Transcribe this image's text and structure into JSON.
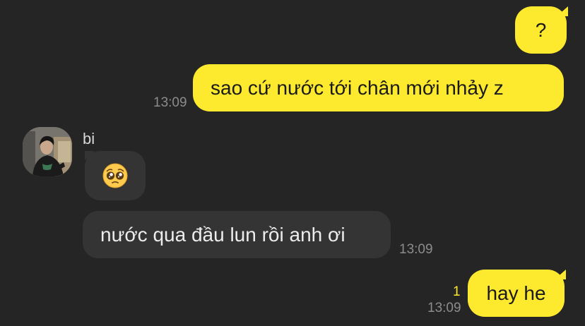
{
  "messages": [
    {
      "direction": "outgoing",
      "text": "?"
    },
    {
      "direction": "outgoing",
      "text": "sao cứ nước tới chân mới nhảy z",
      "time": "13:09"
    },
    {
      "direction": "incoming",
      "sender": "bi",
      "emoji": "pleading-face-emoji"
    },
    {
      "direction": "incoming",
      "text": "nước qua đầu lun rồi anh ơi",
      "time": "13:09"
    },
    {
      "direction": "outgoing",
      "text": "hay he",
      "time": "13:09",
      "unread_count": "1"
    }
  ],
  "colors": {
    "background": "#252525",
    "outgoing_bubble": "#fde92e",
    "incoming_bubble": "#343434",
    "timestamp": "#8c8c8c",
    "unread_count": "#fde92e"
  }
}
